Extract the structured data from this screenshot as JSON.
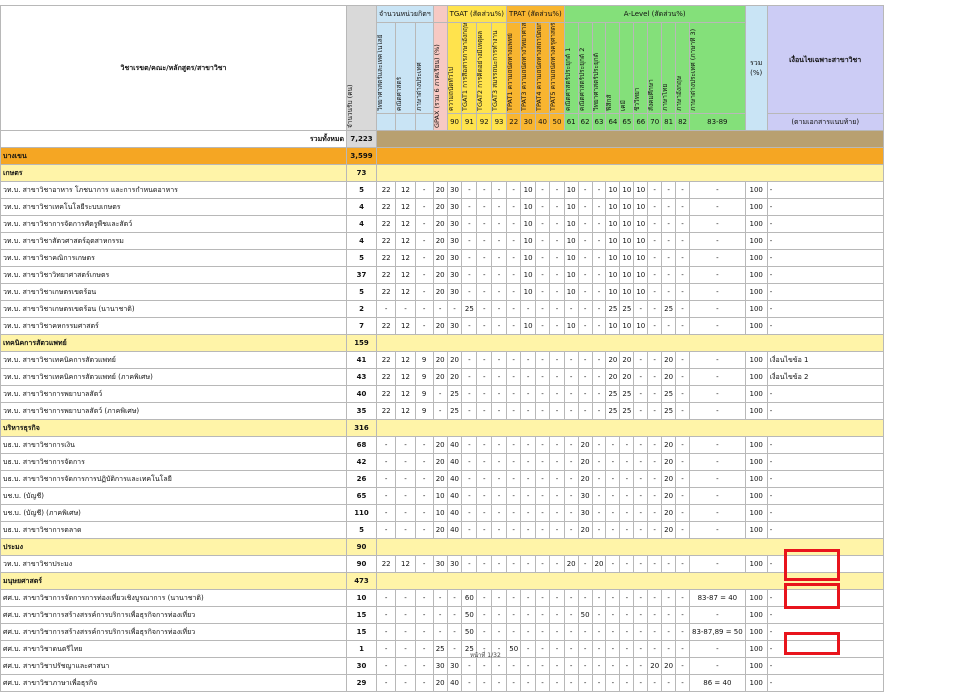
{
  "header": {
    "name_col": "วิชาเรขต/คณะ/หลักสูตร/สาขาวิชา",
    "seats_col": "จำนวนรับ (คน)",
    "units_group": "จำนวนหน่วยกิตฯ",
    "unit_cols": [
      "วิทยาศาสตร์และเทคโนโลยี",
      "คณิตศาสตร์",
      "ภาษาต่างประเทศ"
    ],
    "gpax_col": "GPAX (รวม 6 ภาคเรียน) (%)",
    "tgat_group": "TGAT (สัดส่วน%)",
    "tgat_cols": [
      "ความถนัดทั่วไป",
      "TGAT1 การสื่อสารภาษาอังกฤษ",
      "TGAT2 การคิดอย่างมีเหตุผล",
      "TGAT3 สมรรถนะการทำงาน"
    ],
    "tgat_codes": [
      "90",
      "91",
      "92",
      "93"
    ],
    "tpat_group": "TPAT (สัดส่วน%)",
    "tpat_cols": [
      "TPAT1 ความถนัดทางแพทย์",
      "TPAT3 ความถนัดทางวิทยาศาสตร์",
      "TPAT4 ความถนัดทางสถาปัตยกรรม",
      "TPAT5 ความถนัดทางครุศาสตร์"
    ],
    "tpat_codes": [
      "22",
      "30",
      "40",
      "50"
    ],
    "alevel_group": "A-Level (สัดส่วน%)",
    "alevel_cols": [
      "คณิตศาสตร์ประยุกต์ 1",
      "คณิตศาสตร์ประยุกต์ 2",
      "วิทยาศาสตร์ประยุกต์",
      "ฟิสิกส์",
      "เคมี",
      "ชีววิทยา",
      "สังคมศึกษา",
      "ภาษาไทย",
      "ภาษาอังกฤษ",
      "ภาษาต่างประเทศ (ภาษาที่ 3)"
    ],
    "alevel_codes": [
      "61",
      "62",
      "63",
      "64",
      "65",
      "66",
      "70",
      "81",
      "82",
      "83-89"
    ],
    "total_col": "รวม (%)",
    "cond_col": "เงื่อนไขเฉพาะสาขาวิชา",
    "cond_sub": "(ตามเอกสารแนบท้าย)"
  },
  "total_row": {
    "label": "รวมทั้งหมด",
    "value": "7,223"
  },
  "rows": [
    {
      "kind": "grp",
      "name": "บางเขน",
      "count": "3,599"
    },
    {
      "kind": "sub",
      "name": "เกษตร",
      "count": "73"
    },
    {
      "kind": "item",
      "name": "วท.บ. สาขาวิชาอาหาร โภชนาการ และการกำหนดอาหาร",
      "count": "5",
      "cells": [
        "22",
        "12",
        "-",
        "20",
        "30",
        "-",
        "-",
        "-",
        "-",
        "10",
        "-",
        "-",
        "10",
        "-",
        "-",
        "10",
        "10",
        "10",
        "-",
        "-",
        "-",
        "-",
        "100",
        "-"
      ]
    },
    {
      "kind": "item",
      "name": "วท.บ. สาขาวิชาเทคโนโลยีระบบเกษตร",
      "count": "4",
      "cells": [
        "22",
        "12",
        "-",
        "20",
        "30",
        "-",
        "-",
        "-",
        "-",
        "10",
        "-",
        "-",
        "10",
        "-",
        "-",
        "10",
        "10",
        "10",
        "-",
        "-",
        "-",
        "-",
        "100",
        "-"
      ]
    },
    {
      "kind": "item",
      "name": "วท.บ. สาขาวิชาการจัดการศัตรูพืชและสัตว์",
      "count": "4",
      "cells": [
        "22",
        "12",
        "-",
        "20",
        "30",
        "-",
        "-",
        "-",
        "-",
        "10",
        "-",
        "-",
        "10",
        "-",
        "-",
        "10",
        "10",
        "10",
        "-",
        "-",
        "-",
        "-",
        "100",
        "-"
      ]
    },
    {
      "kind": "item",
      "name": "วท.บ. สาขาวิชาสัตวศาสตร์อุตสาหกรรม",
      "count": "4",
      "cells": [
        "22",
        "12",
        "-",
        "20",
        "30",
        "-",
        "-",
        "-",
        "-",
        "10",
        "-",
        "-",
        "10",
        "-",
        "-",
        "10",
        "10",
        "10",
        "-",
        "-",
        "-",
        "-",
        "100",
        "-"
      ]
    },
    {
      "kind": "item",
      "name": "วท.บ. สาขาวิชาคณิการเกษตร",
      "count": "5",
      "cells": [
        "22",
        "12",
        "-",
        "20",
        "30",
        "-",
        "-",
        "-",
        "-",
        "10",
        "-",
        "-",
        "10",
        "-",
        "-",
        "10",
        "10",
        "10",
        "-",
        "-",
        "-",
        "-",
        "100",
        "-"
      ]
    },
    {
      "kind": "item",
      "name": "วท.บ. สาขาวิชาวิทยาศาสตร์เกษตร",
      "count": "37",
      "cells": [
        "22",
        "12",
        "-",
        "20",
        "30",
        "-",
        "-",
        "-",
        "-",
        "10",
        "-",
        "-",
        "10",
        "-",
        "-",
        "10",
        "10",
        "10",
        "-",
        "-",
        "-",
        "-",
        "100",
        "-"
      ]
    },
    {
      "kind": "item",
      "name": "วท.บ. สาขาวิชาเกษตรเขตร้อน",
      "count": "5",
      "cells": [
        "22",
        "12",
        "-",
        "20",
        "30",
        "-",
        "-",
        "-",
        "-",
        "10",
        "-",
        "-",
        "10",
        "-",
        "-",
        "10",
        "10",
        "10",
        "-",
        "-",
        "-",
        "-",
        "100",
        "-"
      ]
    },
    {
      "kind": "item",
      "name": "วท.บ. สาขาวิชาเกษตรเขตร้อน (นานาชาติ)",
      "count": "2",
      "cells": [
        "-",
        "-",
        "-",
        "-",
        "-",
        "25",
        "-",
        "-",
        "-",
        "-",
        "-",
        "-",
        "-",
        "-",
        "-",
        "25",
        "25",
        "-",
        "-",
        "25",
        "-",
        "-",
        "100",
        "-"
      ]
    },
    {
      "kind": "item",
      "name": "วท.บ. สาขาวิชาคหกรรมศาสตร์",
      "count": "7",
      "cells": [
        "22",
        "12",
        "-",
        "20",
        "30",
        "-",
        "-",
        "-",
        "-",
        "10",
        "-",
        "-",
        "10",
        "-",
        "-",
        "10",
        "10",
        "10",
        "-",
        "-",
        "-",
        "-",
        "100",
        "-"
      ]
    },
    {
      "kind": "sub",
      "name": "เทคนิคการสัตวแพทย์",
      "count": "159"
    },
    {
      "kind": "item",
      "name": "วท.บ. สาขาวิชาเทคนิคการสัตวแพทย์",
      "count": "41",
      "cells": [
        "22",
        "12",
        "9",
        "20",
        "20",
        "-",
        "-",
        "-",
        "-",
        "-",
        "-",
        "-",
        "-",
        "-",
        "-",
        "20",
        "20",
        "-",
        "-",
        "20",
        "-",
        "-",
        "100",
        "เงื่อนไขข้อ 1"
      ]
    },
    {
      "kind": "item",
      "name": "วท.บ. สาขาวิชาเทคนิคการสัตวแพทย์ (ภาคพิเศษ)",
      "count": "43",
      "cells": [
        "22",
        "12",
        "9",
        "20",
        "20",
        "-",
        "-",
        "-",
        "-",
        "-",
        "-",
        "-",
        "-",
        "-",
        "-",
        "20",
        "20",
        "-",
        "-",
        "20",
        "-",
        "-",
        "100",
        "เงื่อนไขข้อ 2"
      ]
    },
    {
      "kind": "item",
      "name": "วท.บ. สาขาวิชาการพยาบาลสัตว์",
      "count": "40",
      "cells": [
        "22",
        "12",
        "9",
        "-",
        "25",
        "-",
        "-",
        "-",
        "-",
        "-",
        "-",
        "-",
        "-",
        "-",
        "-",
        "25",
        "25",
        "-",
        "-",
        "25",
        "-",
        "-",
        "100",
        "-"
      ]
    },
    {
      "kind": "item",
      "name": "วท.บ. สาขาวิชาการพยาบาลสัตว์ (ภาคพิเศษ)",
      "count": "35",
      "cells": [
        "22",
        "12",
        "9",
        "-",
        "25",
        "-",
        "-",
        "-",
        "-",
        "-",
        "-",
        "-",
        "-",
        "-",
        "-",
        "25",
        "25",
        "-",
        "-",
        "25",
        "-",
        "-",
        "100",
        "-"
      ]
    },
    {
      "kind": "sub",
      "name": "บริหารธุรกิจ",
      "count": "316"
    },
    {
      "kind": "item",
      "name": "บธ.บ. สาขาวิชาการเงิน",
      "count": "68",
      "cells": [
        "-",
        "-",
        "-",
        "20",
        "40",
        "-",
        "-",
        "-",
        "-",
        "-",
        "-",
        "-",
        "-",
        "20",
        "-",
        "-",
        "-",
        "-",
        "-",
        "20",
        "-",
        "-",
        "100",
        "-"
      ]
    },
    {
      "kind": "item",
      "name": "บธ.บ. สาขาวิชาการจัดการ",
      "count": "42",
      "cells": [
        "-",
        "-",
        "-",
        "20",
        "40",
        "-",
        "-",
        "-",
        "-",
        "-",
        "-",
        "-",
        "-",
        "20",
        "-",
        "-",
        "-",
        "-",
        "-",
        "20",
        "-",
        "-",
        "100",
        "-"
      ]
    },
    {
      "kind": "item",
      "name": "บธ.บ. สาขาวิชาการจัดการการปฏิบัติการและเทคโนโลยี",
      "count": "26",
      "cells": [
        "-",
        "-",
        "-",
        "20",
        "40",
        "-",
        "-",
        "-",
        "-",
        "-",
        "-",
        "-",
        "-",
        "20",
        "-",
        "-",
        "-",
        "-",
        "-",
        "20",
        "-",
        "-",
        "100",
        "-"
      ]
    },
    {
      "kind": "item",
      "name": "บช.บ. (บัญชี)",
      "count": "65",
      "cells": [
        "-",
        "-",
        "-",
        "10",
        "40",
        "-",
        "-",
        "-",
        "-",
        "-",
        "-",
        "-",
        "-",
        "30",
        "-",
        "-",
        "-",
        "-",
        "-",
        "20",
        "-",
        "-",
        "100",
        "-"
      ]
    },
    {
      "kind": "item",
      "name": "บช.บ. (บัญชี) (ภาคพิเศษ)",
      "count": "110",
      "cells": [
        "-",
        "-",
        "-",
        "10",
        "40",
        "-",
        "-",
        "-",
        "-",
        "-",
        "-",
        "-",
        "-",
        "30",
        "-",
        "-",
        "-",
        "-",
        "-",
        "20",
        "-",
        "-",
        "100",
        "-"
      ]
    },
    {
      "kind": "item",
      "name": "บธ.บ. สาขาวิชาการตลาด",
      "count": "5",
      "cells": [
        "-",
        "-",
        "-",
        "20",
        "40",
        "-",
        "-",
        "-",
        "-",
        "-",
        "-",
        "-",
        "-",
        "20",
        "-",
        "-",
        "-",
        "-",
        "-",
        "20",
        "-",
        "-",
        "100",
        "-"
      ]
    },
    {
      "kind": "sub",
      "name": "ประมง",
      "count": "90"
    },
    {
      "kind": "item",
      "name": "วท.บ. สาขาวิชาประมง",
      "count": "90",
      "cells": [
        "22",
        "12",
        "-",
        "30",
        "30",
        "-",
        "-",
        "-",
        "-",
        "-",
        "-",
        "-",
        "20",
        "-",
        "20",
        "-",
        "-",
        "-",
        "-",
        "-",
        "-",
        "-",
        "100",
        "-"
      ]
    },
    {
      "kind": "sub",
      "name": "มนุษยศาสตร์",
      "count": "473"
    },
    {
      "kind": "item",
      "name": "ศศ.บ. สาขาวิชาการจัดการการท่องเที่ยวเชิงบูรณาการ (นานาชาติ)",
      "count": "10",
      "cells": [
        "-",
        "-",
        "-",
        "-",
        "-",
        "60",
        "-",
        "-",
        "-",
        "-",
        "-",
        "-",
        "-",
        "-",
        "-",
        "-",
        "-",
        "-",
        "-",
        "-",
        "-",
        "83-87 = 40",
        "100",
        "-"
      ]
    },
    {
      "kind": "item",
      "name": "ศศ.บ. สาขาวิชาการสร้างสรรค์การบริการเพื่อธุรกิจการท่องเที่ยว",
      "count": "15",
      "cells": [
        "-",
        "-",
        "-",
        "-",
        "-",
        "50",
        "-",
        "-",
        "-",
        "-",
        "-",
        "-",
        "-",
        "50",
        "-",
        "-",
        "-",
        "-",
        "-",
        "-",
        "-",
        "-",
        "100",
        "-"
      ]
    },
    {
      "kind": "item",
      "name": "ศศ.บ. สาขาวิชาการสร้างสรรค์การบริการเพื่อธุรกิจการท่องเที่ยว",
      "count": "15",
      "cells": [
        "-",
        "-",
        "-",
        "-",
        "-",
        "50",
        "-",
        "-",
        "-",
        "-",
        "-",
        "-",
        "-",
        "-",
        "-",
        "-",
        "-",
        "-",
        "-",
        "-",
        "-",
        "83-87,89 = 50",
        "100",
        "-"
      ]
    },
    {
      "kind": "item",
      "name": "ศศ.บ. สาขาวิชาดนตรีไทย",
      "count": "1",
      "cells": [
        "-",
        "-",
        "-",
        "25",
        "-",
        "25",
        "-",
        "-",
        "50",
        "-",
        "-",
        "-",
        "-",
        "-",
        "-",
        "-",
        "-",
        "-",
        "-",
        "-",
        "-",
        "-",
        "100",
        "-"
      ]
    },
    {
      "kind": "item",
      "name": "ศศ.บ. สาขาวิชาปรัชญาและศาสนา",
      "count": "30",
      "cells": [
        "-",
        "-",
        "-",
        "30",
        "30",
        "-",
        "-",
        "-",
        "-",
        "-",
        "-",
        "-",
        "-",
        "-",
        "-",
        "-",
        "-",
        "-",
        "20",
        "20",
        "-",
        "-",
        "100",
        "-"
      ]
    },
    {
      "kind": "item",
      "name": "ศศ.บ. สาขาวิชาภาษาเพื่อธุรกิจ",
      "count": "29",
      "cells": [
        "-",
        "-",
        "-",
        "20",
        "40",
        "-",
        "-",
        "-",
        "-",
        "-",
        "-",
        "-",
        "-",
        "-",
        "-",
        "-",
        "-",
        "-",
        "-",
        "-",
        "-",
        "86 = 40",
        "100",
        "-"
      ]
    }
  ],
  "footer_note": "หน้าที่ 1/32"
}
